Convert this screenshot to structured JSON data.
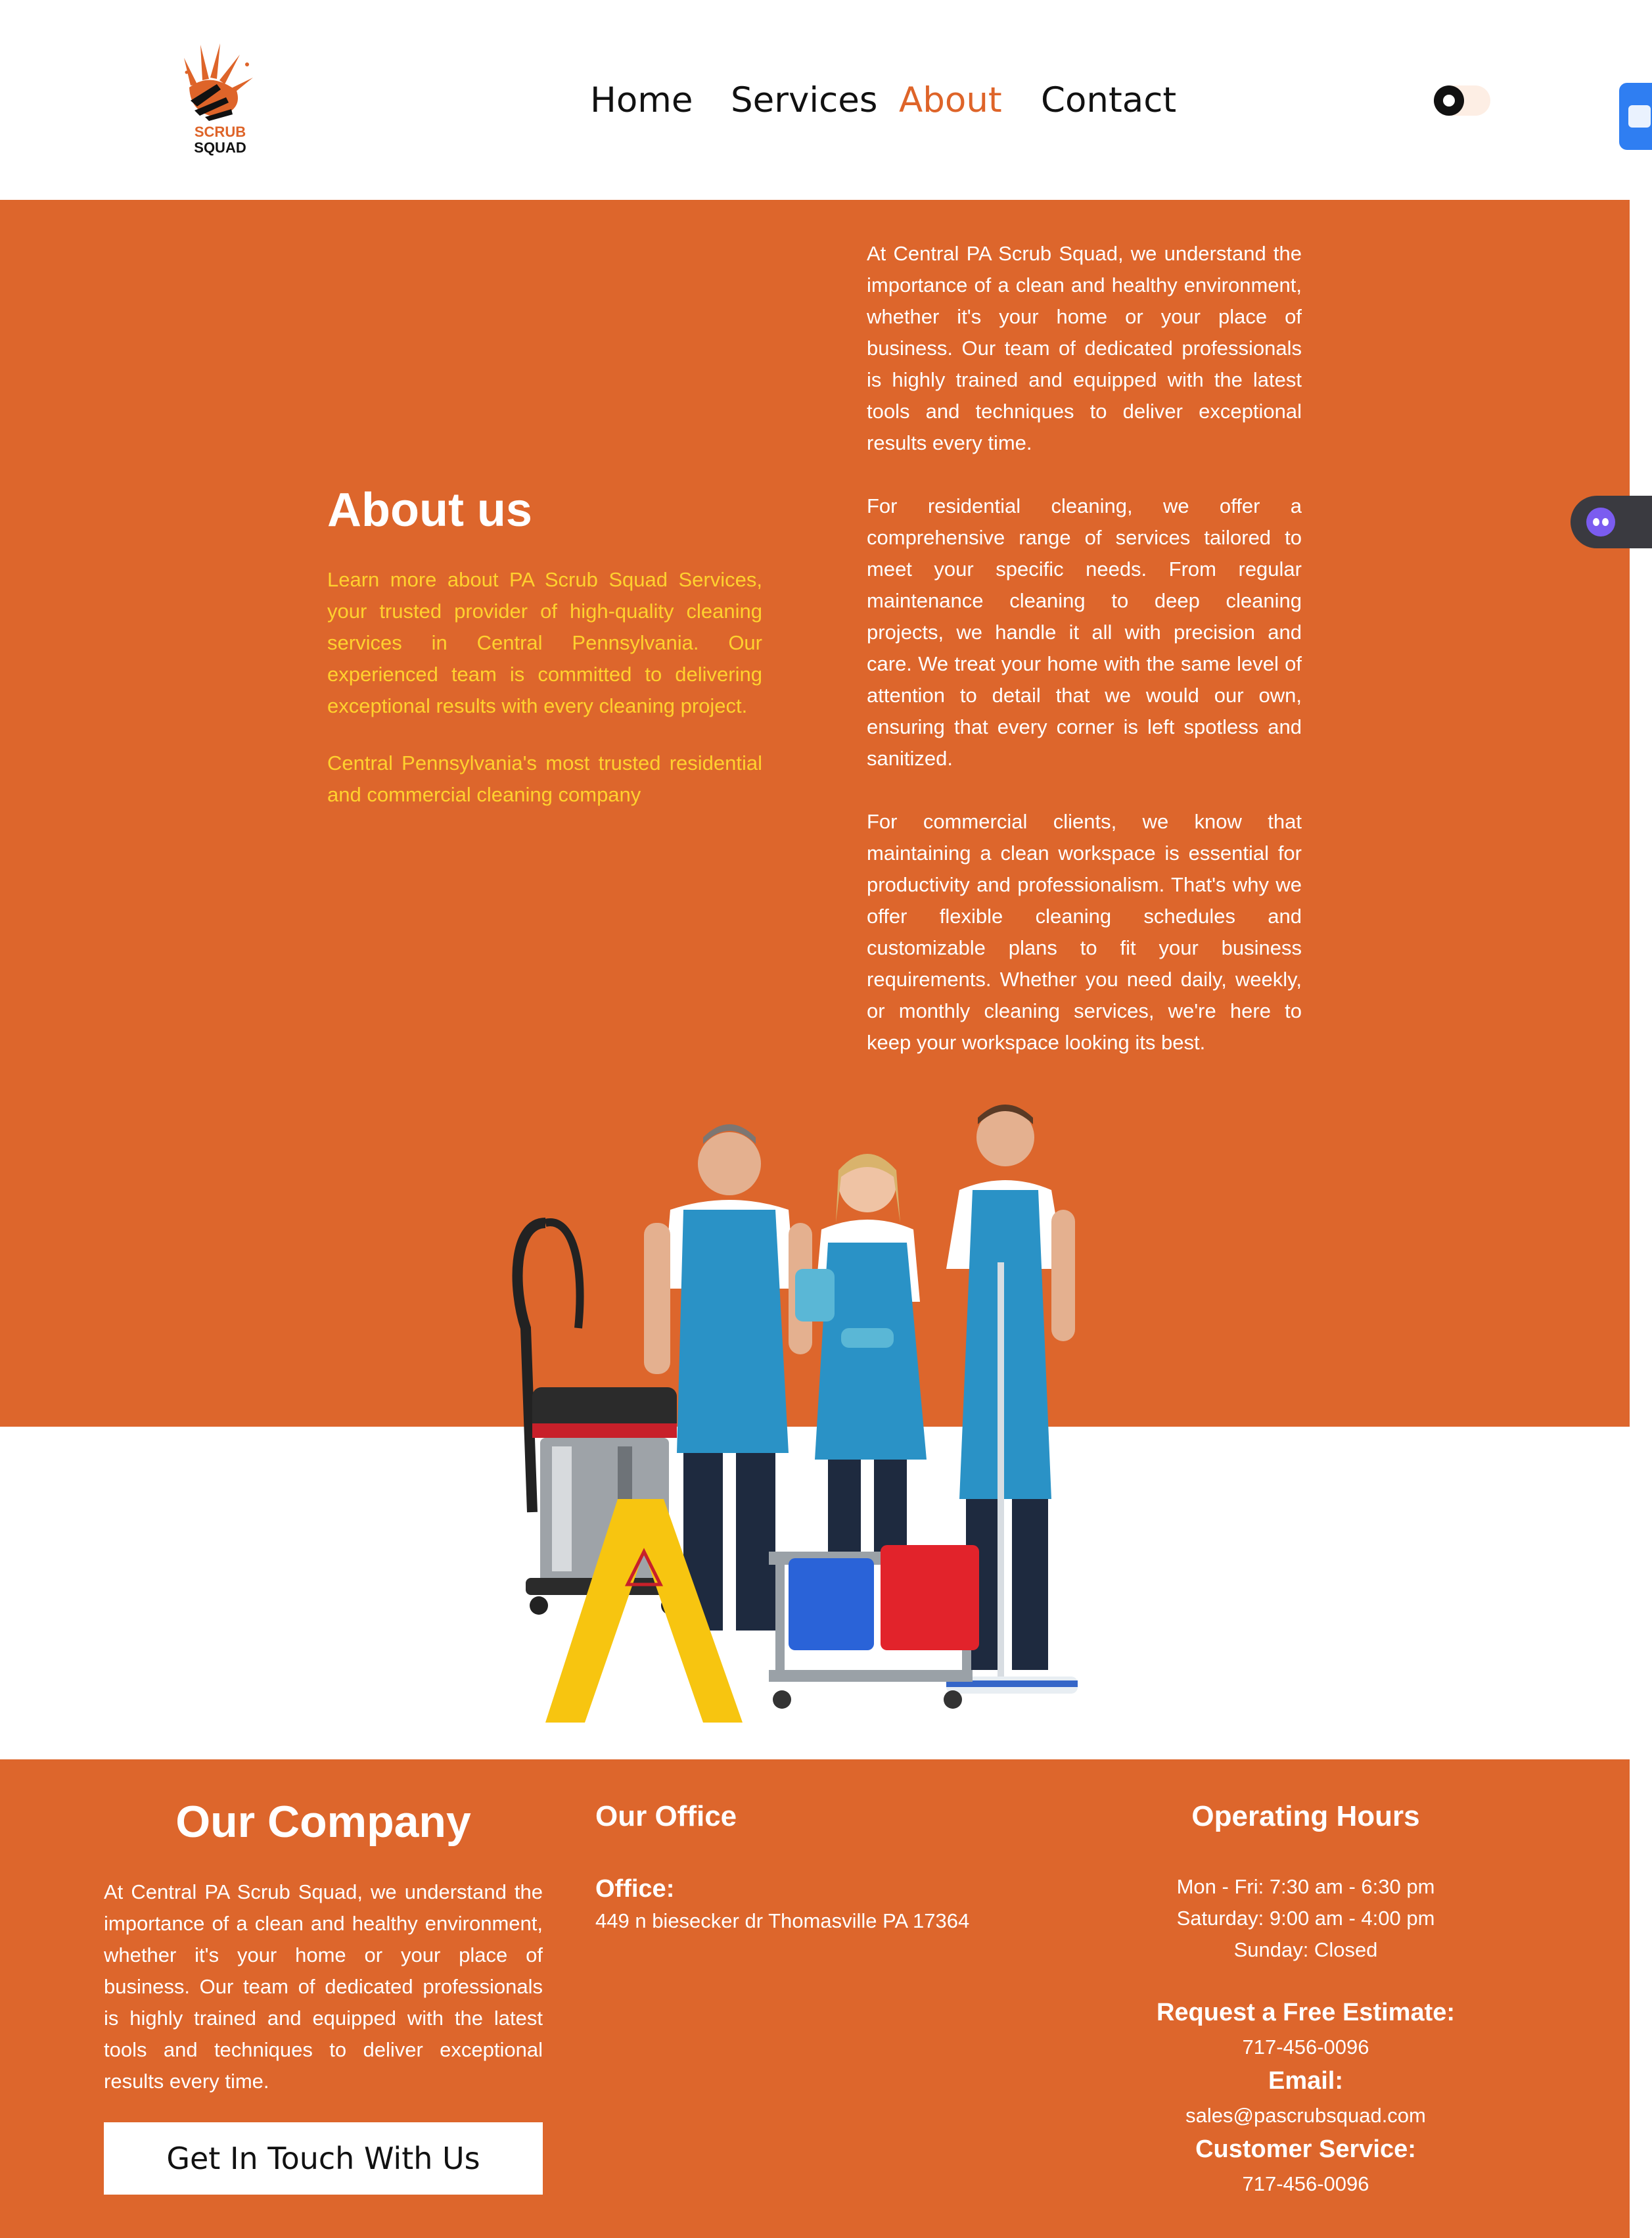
{
  "brand": {
    "logo_top": "SCRUB",
    "logo_bottom": "SQUAD",
    "accent": "#dd662c",
    "highlight": "#ffd12e"
  },
  "nav": {
    "items": [
      {
        "label": "Home",
        "active": false
      },
      {
        "label": "Services",
        "active": false
      },
      {
        "label": "About",
        "active": true
      },
      {
        "label": "Contact",
        "active": false
      }
    ]
  },
  "about": {
    "title": "About us",
    "intro": "Learn more about PA Scrub Squad Services, your trusted provider of high-quality cleaning services in Central Pennsylvania. Our experienced team is committed to delivering exceptional results with every cleaning project.",
    "tagline": "Central Pennsylvania's most trusted residential and commercial cleaning company",
    "paragraphs": [
      "At Central PA Scrub Squad, we understand the importance of a clean and healthy environment, whether it's your home or your place of business. Our team of dedicated professionals is highly trained and equipped with the latest tools and techniques to deliver exceptional results every time.",
      "For residential cleaning, we offer a comprehensive range of services tailored to meet your specific needs. From regular maintenance cleaning to deep cleaning projects, we handle it all with precision and care. We treat your home with the same level of attention to detail that we would our own, ensuring that every corner is left spotless and sanitized.",
      "For commercial clients, we know that maintaining a clean workspace is essential for productivity and professionalism. That's why we offer flexible cleaning schedules and customizable plans to fit your business requirements. Whether you need daily, weekly, or monthly cleaning services, we're here to keep your workspace looking its best."
    ]
  },
  "footer": {
    "company": {
      "title": "Our Company",
      "text": "At Central PA Scrub Squad, we understand the importance of a clean and healthy environment, whether it's your home or your place of business. Our team of dedicated professionals is highly trained and equipped with the latest tools and techniques to deliver exceptional results every time.",
      "button": "Get In Touch With Us"
    },
    "office": {
      "title": "Our Office",
      "label": "Office:",
      "address": "449 n biesecker dr Thomasville PA 17364"
    },
    "hours": {
      "title": "Operating Hours",
      "lines": [
        "Mon - Fri: 7:30 am - 6:30 pm",
        "Saturday: 9:00 am - 4:00 pm",
        "Sunday: Closed"
      ],
      "estimate_label": "Request a Free Estimate:",
      "estimate_value": "717-456-0096",
      "email_label": "Email:",
      "email_value": "sales@pascrubsquad.com",
      "service_label": "Customer Service:",
      "service_value": "717-456-0096"
    }
  }
}
